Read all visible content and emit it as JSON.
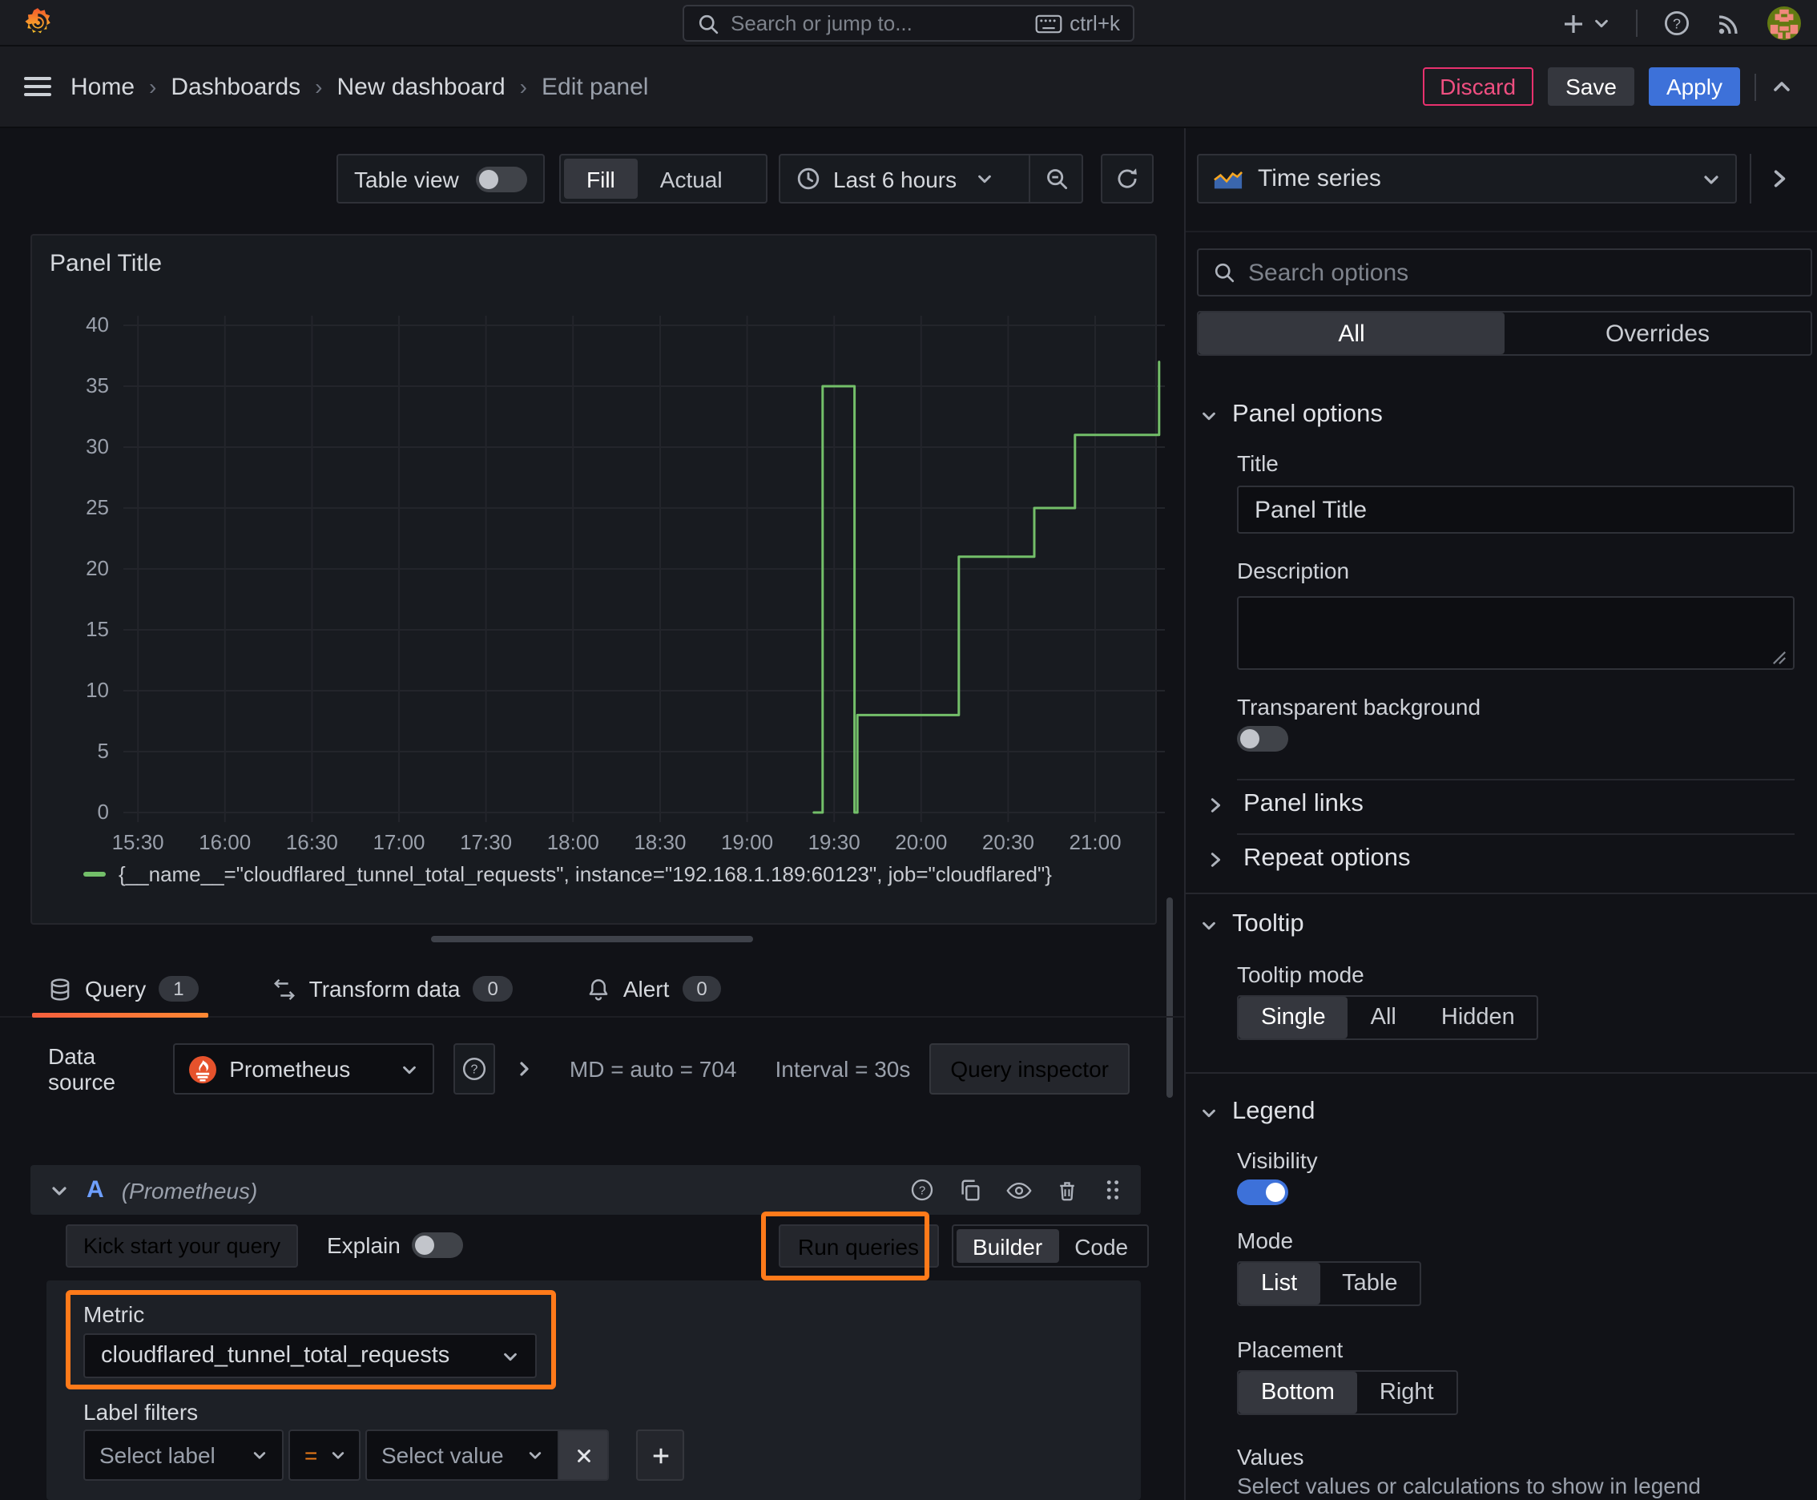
{
  "topnav": {
    "search_placeholder": "Search or jump to...",
    "search_shortcut": "ctrl+k"
  },
  "breadcrumb": {
    "items": [
      "Home",
      "Dashboards",
      "New dashboard",
      "Edit panel"
    ]
  },
  "actions": {
    "discard": "Discard",
    "save": "Save",
    "apply": "Apply"
  },
  "viz_toolbar": {
    "table_view_label": "Table view",
    "fill_label": "Fill",
    "actual_label": "Actual",
    "time_range_label": "Last 6 hours"
  },
  "panel": {
    "title": "Panel Title"
  },
  "chart_data": {
    "type": "line",
    "step": true,
    "title": "Panel Title",
    "x_range": [
      "15:25",
      "21:24"
    ],
    "ylim": [
      0,
      40
    ],
    "y_ticks": [
      0,
      5,
      10,
      15,
      20,
      25,
      30,
      35,
      40
    ],
    "x_ticks": [
      "15:30",
      "16:00",
      "16:30",
      "17:00",
      "17:30",
      "18:00",
      "18:30",
      "19:00",
      "19:30",
      "20:00",
      "20:30",
      "21:00"
    ],
    "grid": true,
    "legend_position": "bottom",
    "series": [
      {
        "name": "{__name__=\"cloudflared_tunnel_total_requests\", instance=\"192.168.1.189:60123\", job=\"cloudflared\"}",
        "color": "#73bf69",
        "points": [
          [
            "19:23",
            0
          ],
          [
            "19:26",
            0
          ],
          [
            "19:26",
            35
          ],
          [
            "19:37",
            35
          ],
          [
            "19:37",
            0
          ],
          [
            "19:38",
            0
          ],
          [
            "19:38",
            8
          ],
          [
            "20:13",
            8
          ],
          [
            "20:13",
            21
          ],
          [
            "20:39",
            21
          ],
          [
            "20:39",
            25
          ],
          [
            "20:53",
            25
          ],
          [
            "20:53",
            31
          ],
          [
            "21:22",
            31
          ],
          [
            "21:22",
            37
          ]
        ]
      }
    ]
  },
  "query_tabs": {
    "query": {
      "label": "Query",
      "count": "1"
    },
    "transform": {
      "label": "Transform data",
      "count": "0"
    },
    "alert": {
      "label": "Alert",
      "count": "0"
    }
  },
  "datasource_bar": {
    "label": "Data source",
    "selected": "Prometheus",
    "stat_md": "MD = auto = 704",
    "stat_interval": "Interval = 30s",
    "inspector_label": "Query inspector"
  },
  "query_editor": {
    "ref_id": "A",
    "datasource_hint": "(Prometheus)",
    "kick_start_label": "Kick start your query",
    "explain_label": "Explain",
    "run_queries_label": "Run queries",
    "builder_label": "Builder",
    "code_label": "Code",
    "metric": {
      "label": "Metric",
      "value": "cloudflared_tunnel_total_requests"
    },
    "label_filters": {
      "label": "Label filters",
      "select_label_placeholder": "Select label",
      "operator": "=",
      "select_value_placeholder": "Select value"
    }
  },
  "options_pane": {
    "viz_picker": {
      "name": "Time series"
    },
    "search_placeholder": "Search options",
    "tabs": {
      "all": "All",
      "overrides": "Overrides"
    },
    "panel_options": {
      "title": "Panel options",
      "title_field": {
        "label": "Title",
        "value": "Panel Title"
      },
      "description_field": {
        "label": "Description"
      },
      "transparent_label": "Transparent background",
      "panel_links": "Panel links",
      "repeat_options": "Repeat options"
    },
    "tooltip": {
      "title": "Tooltip",
      "mode_label": "Tooltip mode",
      "modes": [
        "Single",
        "All",
        "Hidden"
      ],
      "selected_mode": "Single"
    },
    "legend": {
      "title": "Legend",
      "visibility_label": "Visibility",
      "mode_label": "Mode",
      "modes": [
        "List",
        "Table"
      ],
      "selected_mode": "List",
      "placement_label": "Placement",
      "placements": [
        "Bottom",
        "Right"
      ],
      "selected_placement": "Bottom",
      "values_label": "Values",
      "values_hint": "Select values or calculations to show in legend"
    }
  },
  "colors": {
    "accent_blue": "#3d71d9",
    "annotation_orange": "#ff7a1a",
    "series_green": "#73bf69",
    "discard_pink": "#e8316e"
  }
}
